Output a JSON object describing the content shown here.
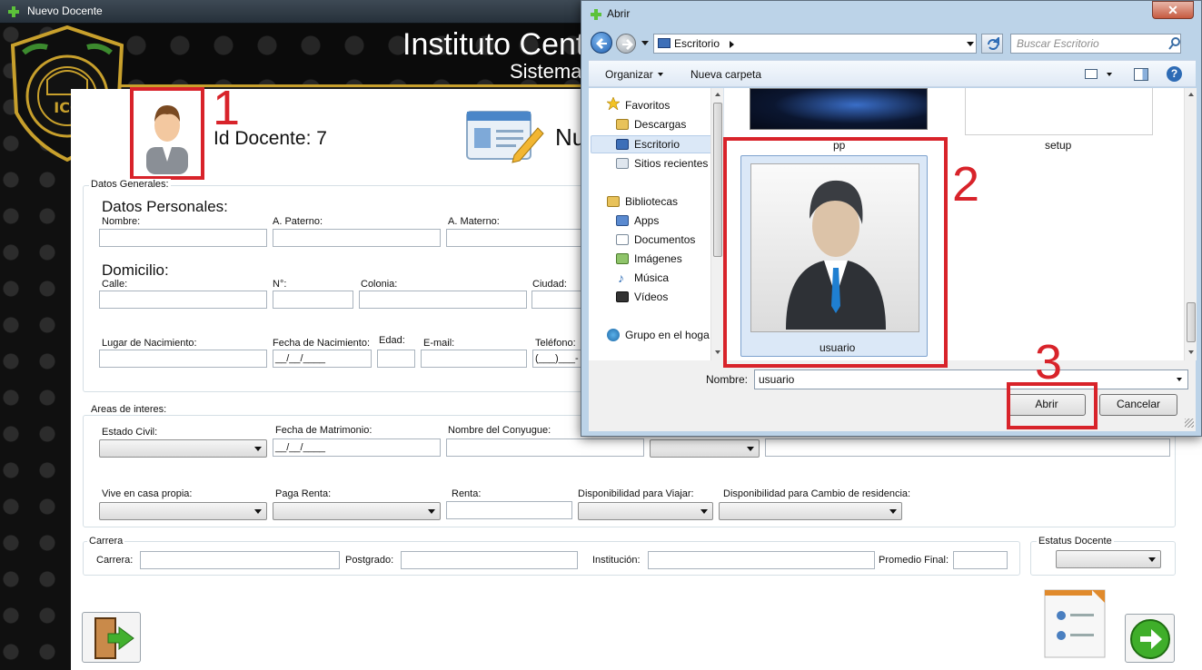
{
  "main_window": {
    "title": "Nuevo Docente",
    "header_title": "Instituto Cent",
    "header_subtitle": "Sistema",
    "logo_letters": "ICC",
    "id_docente_label": "Id Docente: 7",
    "heading_partial": "Nu",
    "annotation_1": "1",
    "datos_generales": {
      "group_label": "Datos Generales:",
      "datos_personales_heading": "Datos Personales:",
      "nombre_label": "Nombre:",
      "a_paterno_label": "A. Paterno:",
      "a_materno_label": "A. Materno:",
      "domicilio_heading": "Domicilio:",
      "calle_label": "Calle:",
      "numero_label": "N°:",
      "colonia_label": "Colonia:",
      "ciudad_label": "Ciudad:",
      "lugar_nacimiento_label": "Lugar de Nacimiento:",
      "fecha_nacimiento_label": "Fecha de Nacimiento:",
      "fecha_nacimiento_value": "__/__/____",
      "edad_label": "Edad:",
      "email_label": "E-mail:",
      "telefono_label": "Teléfono:",
      "telefono_value": "(___)___-"
    },
    "areas_interes": {
      "group_label": "Areas de interes:",
      "estado_civil_label": "Estado Civil:",
      "fecha_matrimonio_label": "Fecha de Matrimonio:",
      "fecha_matrimonio_value": "__/__/____",
      "nombre_conyugue_label": "Nombre del Conyugue:",
      "vive_casa_propia_label": "Vive en casa propia:",
      "paga_renta_label": "Paga Renta:",
      "renta_label": "Renta:",
      "disp_viajar_label": "Disponibilidad para Viajar:",
      "disp_cambio_label": "Disponibilidad para Cambio de residencia:"
    },
    "carrera": {
      "group_label": "Carrera",
      "carrera_label": "Carrera:",
      "postgrado_label": "Postgrado:",
      "institucion_label": "Institución:",
      "promedio_label": "Promedio Final:"
    },
    "estatus": {
      "group_label": "Estatus Docente"
    }
  },
  "dialog": {
    "title": "Abrir",
    "close_glyph": "✕",
    "address": "Escritorio",
    "search_placeholder": "Buscar Escritorio",
    "toolbar": {
      "organizar": "Organizar",
      "nueva_carpeta": "Nueva carpeta"
    },
    "nav": {
      "favoritos": "Favoritos",
      "descargas": "Descargas",
      "escritorio": "Escritorio",
      "sitios_recientes": "Sitios recientes",
      "bibliotecas": "Bibliotecas",
      "apps": "Apps",
      "documentos": "Documentos",
      "imagenes": "Imágenes",
      "musica": "Música",
      "videos": "Vídeos",
      "grupo_hogar": "Grupo en el hoga"
    },
    "files": {
      "pp": "pp",
      "setup": "setup",
      "usuario": "usuario"
    },
    "annotation_2": "2",
    "annotation_3": "3",
    "nombre_label": "Nombre:",
    "nombre_value": "usuario",
    "abrir_button": "Abrir",
    "cancelar_button": "Cancelar"
  },
  "colors": {
    "annotation_red": "#d8232a",
    "header_gold": "#c8a02c",
    "dialog_frame": "#bcd3e8"
  }
}
